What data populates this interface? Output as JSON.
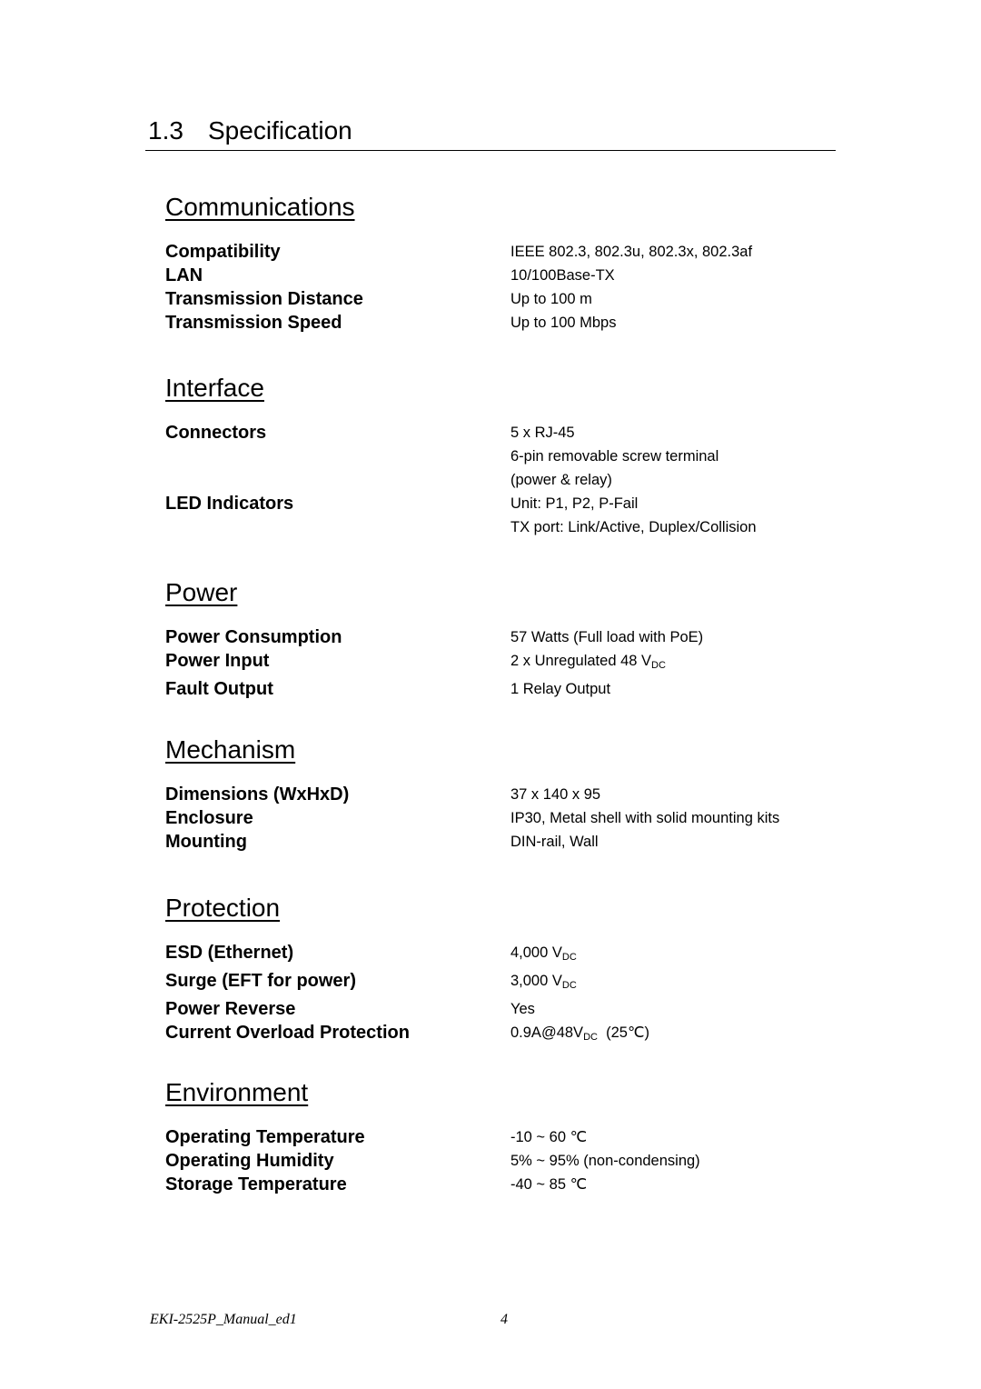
{
  "page": {
    "section_number": "1.3",
    "section_title": "Specification"
  },
  "sections": [
    {
      "heading": "Communications",
      "rows": [
        {
          "label": "Compatibility",
          "values": [
            "IEEE 802.3, 802.3u, 802.3x, 802.3af"
          ]
        },
        {
          "label": "LAN",
          "values": [
            "10/100Base-TX"
          ]
        },
        {
          "label": "Transmission Distance",
          "values": [
            "Up to 100 m"
          ]
        },
        {
          "label": "Transmission Speed",
          "values": [
            "Up to 100 Mbps"
          ]
        }
      ]
    },
    {
      "heading": "Interface",
      "rows": [
        {
          "label": "Connectors",
          "values": [
            "5 x RJ-45",
            "6-pin removable screw terminal",
            "(power & relay)"
          ]
        },
        {
          "label": "LED Indicators",
          "values": [
            "Unit: P1, P2, P-Fail",
            "TX port: Link/Active, Duplex/Collision"
          ]
        }
      ]
    },
    {
      "heading": "Power",
      "rows": [
        {
          "label": "Power Consumption",
          "values": [
            "57 Watts (Full load with PoE)"
          ]
        },
        {
          "label": "Power Input",
          "values": [
            "2 x Unregulated 48 V"
          ],
          "subscript": "DC"
        },
        {
          "label": "Fault Output",
          "values": [
            "1 Relay Output"
          ]
        }
      ]
    },
    {
      "heading": "Mechanism",
      "rows": [
        {
          "label": "Dimensions (WxHxD)",
          "values": [
            "37 x 140 x 95"
          ]
        },
        {
          "label": "Enclosure",
          "values": [
            "IP30, Metal shell with solid mounting kits"
          ]
        },
        {
          "label": "Mounting",
          "values": [
            "DIN-rail, Wall"
          ]
        }
      ]
    },
    {
      "heading": "Protection",
      "rows": [
        {
          "label": "ESD (Ethernet)",
          "values": [
            "4,000 V"
          ],
          "subscript": "DC"
        },
        {
          "label": "Surge (EFT for power)",
          "values": [
            "3,000 V"
          ],
          "subscript": "DC"
        },
        {
          "label": "Power Reverse",
          "values": [
            "Yes"
          ]
        },
        {
          "label": "Current Overload Protection",
          "values": [
            "0.9A@48V"
          ],
          "subscript": "DC",
          "suffix": "  (25℃)"
        }
      ]
    },
    {
      "heading": "Environment",
      "rows": [
        {
          "label": "Operating Temperature",
          "values": [
            "-10 ~ 60 ℃"
          ]
        },
        {
          "label": "Operating Humidity",
          "values": [
            "5% ~ 95% (non-condensing)"
          ]
        },
        {
          "label": "Storage Temperature",
          "values": [
            "-40 ~ 85 ℃"
          ]
        }
      ]
    }
  ],
  "footer": {
    "document_name": "EKI-2525P_Manual_ed1",
    "page_number": "4"
  }
}
